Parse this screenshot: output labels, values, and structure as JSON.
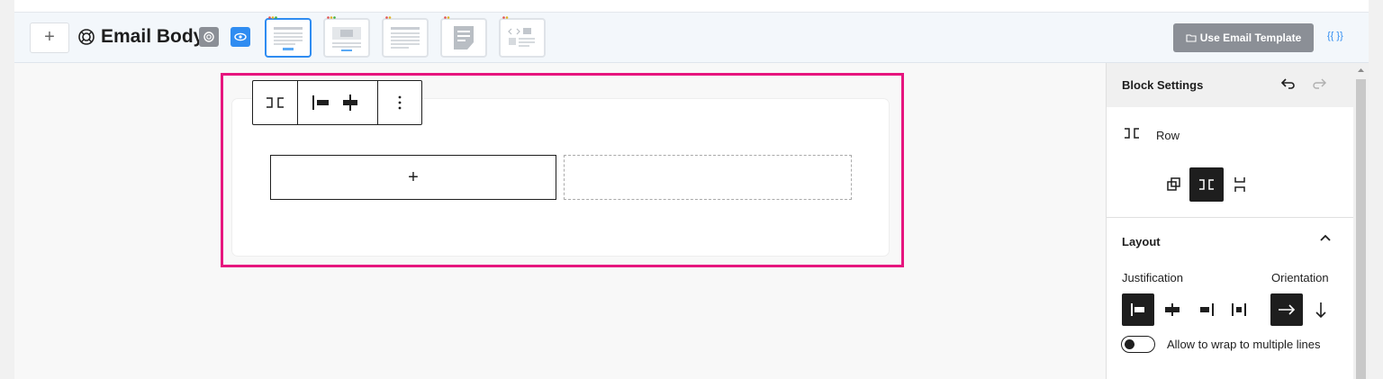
{
  "header": {
    "add_label": "+",
    "title": "Email Body",
    "use_template_label": "Use Email Template",
    "merge_tags_label": "{{ }}",
    "thumbnails": [
      "layout-1",
      "layout-2",
      "layout-3",
      "layout-4",
      "layout-5"
    ]
  },
  "canvas": {
    "column_add_label": "+"
  },
  "panel": {
    "title": "Block Settings",
    "block_name": "Row",
    "layout_label": "Layout",
    "justification_label": "Justification",
    "orientation_label": "Orientation",
    "wrap_label": "Allow to wrap to multiple lines"
  },
  "colors": {
    "accent": "#2f8cf1",
    "highlight": "#e6157e",
    "dark": "#1e1e1e",
    "button_gray": "#8b8f96"
  }
}
